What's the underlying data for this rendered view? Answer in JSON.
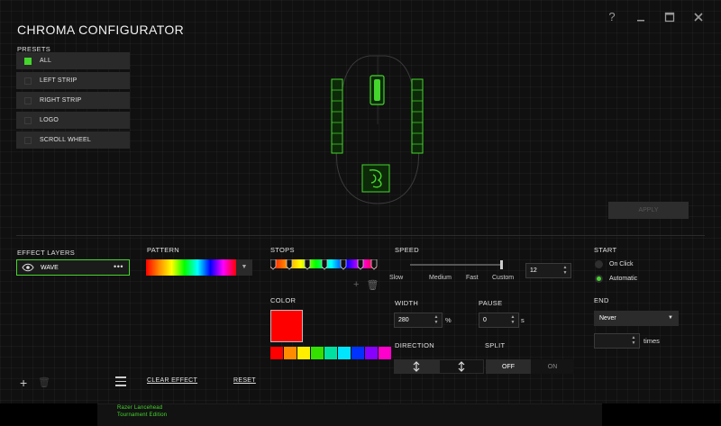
{
  "app": {
    "title": "CHROMA CONFIGURATOR",
    "help_icon": "help-icon",
    "minimize_icon": "minimize-icon",
    "maximize_icon": "maximize-icon",
    "close_icon": "close-icon"
  },
  "presets": {
    "label": "PRESETS",
    "items": [
      {
        "label": "ALL",
        "checked": true
      },
      {
        "label": "LEFT STRIP",
        "checked": false
      },
      {
        "label": "RIGHT STRIP",
        "checked": false
      },
      {
        "label": "LOGO",
        "checked": false
      },
      {
        "label": "SCROLL WHEEL",
        "checked": false
      }
    ]
  },
  "apply_label": "APPLY",
  "effect_layers": {
    "label": "EFFECT LAYERS",
    "layer_name": "WAVE",
    "menu_glyph": "•••"
  },
  "pattern": {
    "label": "PATTERN"
  },
  "stops": {
    "label": "STOPS"
  },
  "color": {
    "label": "COLOR",
    "selected": "#ff0000",
    "swatches": [
      "#ff0000",
      "#ff8c00",
      "#ffee00",
      "#33e000",
      "#00e0a0",
      "#00e5ff",
      "#0033ff",
      "#8800ff",
      "#ff00cc"
    ]
  },
  "speed": {
    "label": "SPEED",
    "slow": "Slow",
    "medium": "Medium",
    "fast": "Fast",
    "custom": "Custom",
    "value": "12",
    "slider_level": 1.0
  },
  "width": {
    "label": "WIDTH",
    "value": "280",
    "unit": "%"
  },
  "pause": {
    "label": "PAUSE",
    "value": "0",
    "unit": "s"
  },
  "direction": {
    "label": "DIRECTION"
  },
  "split": {
    "label": "SPLIT",
    "off": "OFF",
    "on": "ON"
  },
  "start": {
    "label": "START",
    "on_click": "On Click",
    "automatic": "Automatic"
  },
  "end": {
    "label": "END",
    "select_value": "Never",
    "times_value": "",
    "times_label": "times"
  },
  "bottom": {
    "clear_effect": "CLEAR EFFECT",
    "reset": "RESET"
  },
  "device_caption": {
    "line1": "Razer Lancehead",
    "line2": "Tournament Edition"
  },
  "colors": {
    "accent": "#44d62c",
    "background": "#101010"
  }
}
